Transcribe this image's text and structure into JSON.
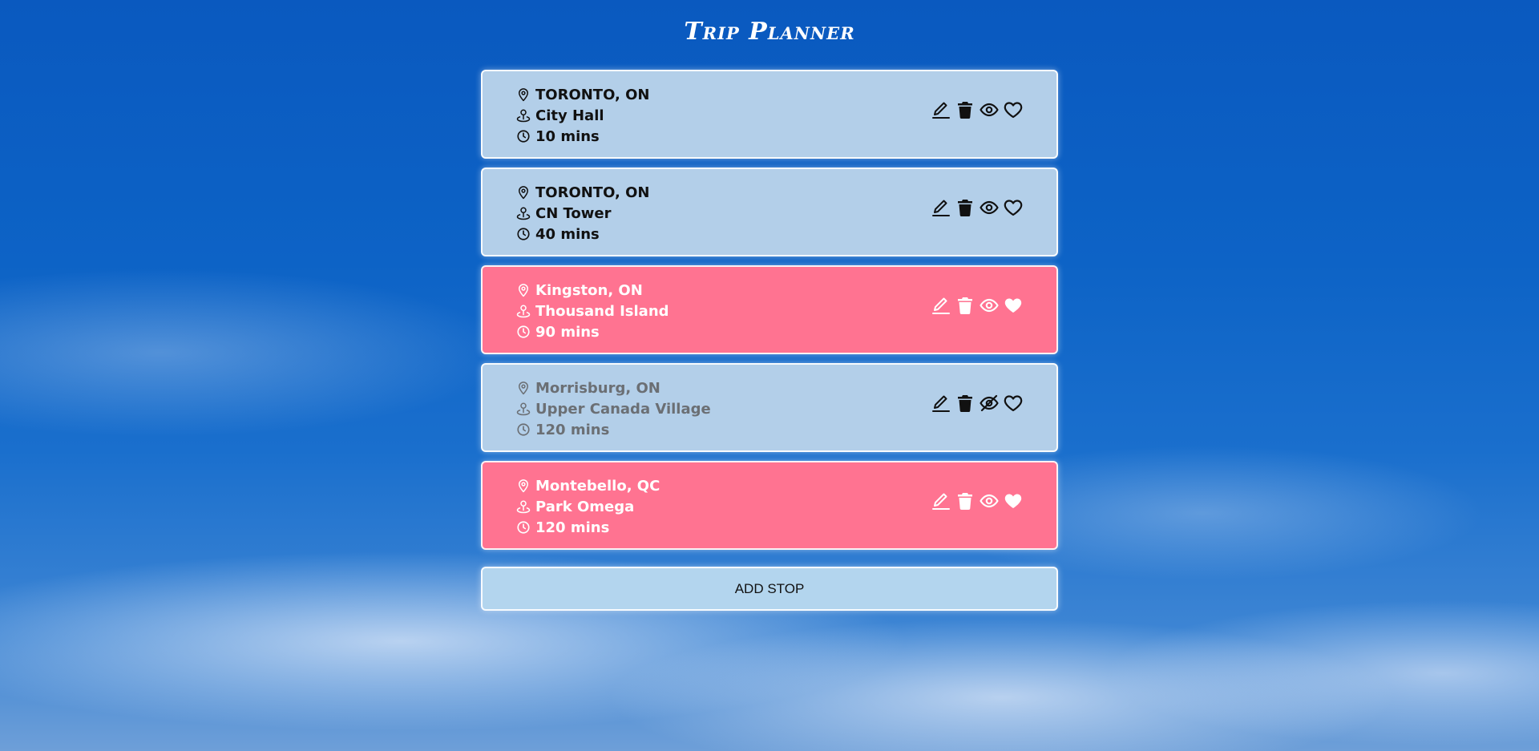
{
  "app": {
    "title": "Trip Planner"
  },
  "colors": {
    "card_default": "#b3cfe9",
    "card_favorite": "#ff7391",
    "hidden_text": "#6b6f74"
  },
  "stops": [
    {
      "location": "TORONTO, ON",
      "place": "City Hall",
      "duration": "10 mins",
      "favorite": false,
      "visible": true,
      "icons": [
        "map-pin-icon",
        "person-pin-icon",
        "clock-icon",
        "edit-icon",
        "trash-icon",
        "eye-icon",
        "heart-outline-icon"
      ]
    },
    {
      "location": "TORONTO, ON",
      "place": "CN Tower",
      "duration": "40 mins",
      "favorite": false,
      "visible": true,
      "icons": [
        "map-pin-icon",
        "person-pin-icon",
        "clock-icon",
        "edit-icon",
        "trash-icon",
        "eye-icon",
        "heart-outline-icon"
      ]
    },
    {
      "location": "Kingston, ON",
      "place": "Thousand Island",
      "duration": "90 mins",
      "favorite": true,
      "visible": true,
      "icons": [
        "map-pin-icon",
        "person-pin-icon",
        "clock-icon",
        "edit-icon",
        "trash-icon",
        "eye-icon",
        "heart-filled-icon"
      ]
    },
    {
      "location": "Morrisburg, ON",
      "place": "Upper Canada Village",
      "duration": "120 mins",
      "favorite": false,
      "visible": false,
      "icons": [
        "map-pin-icon",
        "person-pin-icon",
        "clock-icon",
        "edit-icon",
        "trash-icon",
        "eye-slash-icon",
        "heart-outline-icon"
      ]
    },
    {
      "location": "Montebello, QC",
      "place": "Park Omega",
      "duration": "120 mins",
      "favorite": true,
      "visible": true,
      "icons": [
        "map-pin-icon",
        "person-pin-icon",
        "clock-icon",
        "edit-icon",
        "trash-icon",
        "eye-icon",
        "heart-filled-icon"
      ]
    }
  ],
  "add_button": {
    "label": "ADD STOP"
  }
}
